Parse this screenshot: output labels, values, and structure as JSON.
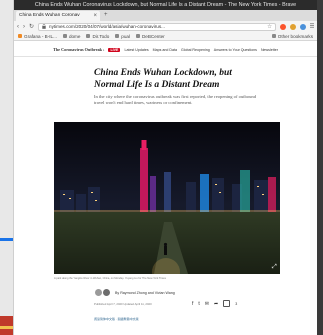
{
  "window": {
    "title": "China Ends Wuhan Coronavirus Lockdown, but Normal Life Is a Distant Dream - The New York Times - Brave",
    "tab_label": "China Ends Wuhan Coronav",
    "tab_close": "×",
    "new_tab": "+"
  },
  "navbar": {
    "back": "‹",
    "forward": "›",
    "reload": "↻",
    "url": "nytimes.com/2020/04/07/world/asia/wuhan-coronavirus...",
    "bookmark_star": "☆"
  },
  "bookmarks": {
    "items": [
      "Grafana - B-IL...",
      "dome",
      "Dir.Todo",
      "pual",
      "DeBCenter"
    ],
    "other": "Other bookmarks"
  },
  "nyt_bar": {
    "brand": "The Coronavirus Outbreak ›",
    "live_label": "LIVE",
    "links": [
      "Latest Updates",
      "Maps and Data",
      "Global Reopening",
      "Answers to Your Questions",
      "Newsletter"
    ]
  },
  "article": {
    "headline": "China Ends Wuhan Lockdown, but Normal Life Is a Distant Dream",
    "summary": "In the city where the coronavirus outbreak was first reported, the reopening of outbound travel won't end hard times, wariness or confinement.",
    "caption": "A park along the Yangtze River in Wuhan, China, on Monday.   Yuyang Liu for The New York Times",
    "byline": "By Raymond Zhong and Vivian Wang",
    "dateline": "Published April 7, 2020   Updated April 11, 2020",
    "comment_count": "3",
    "translations": "阅读简体中文版 · 閱讀繁體中文版"
  },
  "share": {
    "facebook_icon_glyph": "f",
    "twitter_icon_glyph": "t",
    "email_icon_glyph": "✉",
    "forward_icon_glyph": "➦"
  },
  "colors": {
    "live": "#d0021b",
    "link": "#326891",
    "title_bar": "#2b2b2b"
  }
}
